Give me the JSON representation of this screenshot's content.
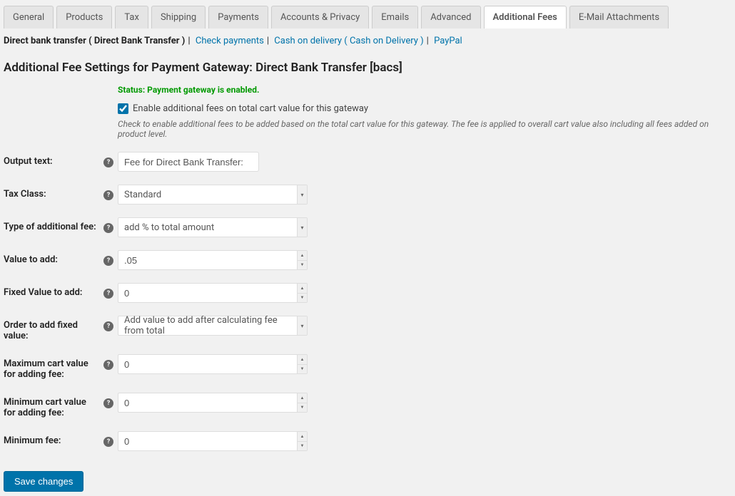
{
  "tabs": [
    {
      "label": "General"
    },
    {
      "label": "Products"
    },
    {
      "label": "Tax"
    },
    {
      "label": "Shipping"
    },
    {
      "label": "Payments"
    },
    {
      "label": "Accounts & Privacy"
    },
    {
      "label": "Emails"
    },
    {
      "label": "Advanced"
    },
    {
      "label": "Additional Fees",
      "active": true
    },
    {
      "label": "E-Mail Attachments"
    }
  ],
  "sublinks": {
    "current": "Direct bank transfer ( Direct Bank Transfer )",
    "items": [
      {
        "label": "Check payments"
      },
      {
        "label": "Cash on delivery ( Cash on Delivery )"
      },
      {
        "label": "PayPal"
      }
    ]
  },
  "heading": "Additional Fee Settings for Payment Gateway: Direct Bank Transfer [bacs]",
  "status": "Status: Payment gateway is enabled.",
  "enable_checkbox": {
    "checked": true,
    "label": "Enable additional fees on total cart value for this gateway",
    "desc": "Check to enable additional fees to be added based on the total cart value for this gateway. The fee is applied to overall cart value also including all fees added on product level."
  },
  "fields": {
    "output_text": {
      "label": "Output text:",
      "value": "Fee for Direct Bank Transfer:"
    },
    "tax_class": {
      "label": "Tax Class:",
      "value": "Standard"
    },
    "type_fee": {
      "label": "Type of additional fee:",
      "value": "add % to total amount"
    },
    "value_add": {
      "label": "Value to add:",
      "value": ".05"
    },
    "fixed_value": {
      "label": "Fixed Value to add:",
      "value": "0"
    },
    "order_fixed": {
      "label": "Order to add fixed value:",
      "value": "Add value to add after calculating fee from total"
    },
    "max_cart": {
      "label": "Maximum cart value for adding fee:",
      "value": "0"
    },
    "min_cart": {
      "label": "Minimum cart value for adding fee:",
      "value": "0"
    },
    "min_fee": {
      "label": "Minimum fee:",
      "value": "0"
    }
  },
  "save_button": "Save changes"
}
